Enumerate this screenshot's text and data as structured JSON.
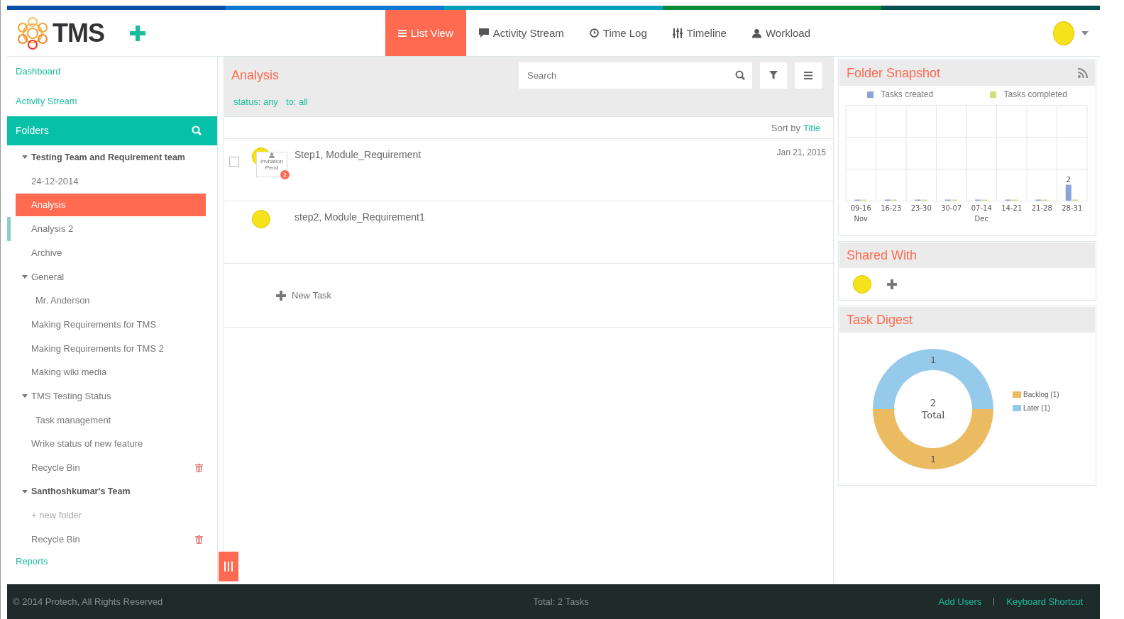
{
  "top_bar": {
    "logo": "TMS",
    "tabs": [
      {
        "label": "List View",
        "selected": true
      },
      {
        "label": "Activity Stream",
        "selected": false
      },
      {
        "label": "Time Log",
        "selected": false
      },
      {
        "label": "Timeline",
        "selected": false
      },
      {
        "label": "Workload",
        "selected": false
      }
    ]
  },
  "sidebar": {
    "links": [
      "Dashboard",
      "Activity Stream"
    ],
    "folders_title": "Folders",
    "tree": [
      {
        "label": "Testing Team and Requirement team",
        "kind": "team",
        "expanded": true,
        "selected": false,
        "highlighted": false,
        "children": [
          {
            "label": "24-12-2014",
            "kind": "folder",
            "selected": false,
            "highlighted": false
          },
          {
            "label": "Analysis",
            "kind": "folder",
            "selected": true,
            "highlighted": false
          },
          {
            "label": "Analysis 2",
            "kind": "folder",
            "selected": false,
            "highlighted": true
          },
          {
            "label": "Archive",
            "kind": "folder",
            "selected": false,
            "highlighted": false
          },
          {
            "label": "General",
            "kind": "folder",
            "expanded": true,
            "selected": false,
            "highlighted": false,
            "children": [
              {
                "label": "Mr. Anderson",
                "kind": "folder",
                "selected": false,
                "highlighted": false
              }
            ]
          },
          {
            "label": "Making Requirements for TMS",
            "kind": "folder",
            "selected": false,
            "highlighted": false
          },
          {
            "label": "Making Requirements for TMS 2",
            "kind": "folder",
            "selected": false,
            "highlighted": false
          },
          {
            "label": "Making wiki media",
            "kind": "folder",
            "selected": false,
            "highlighted": false
          },
          {
            "label": "TMS Testing Status",
            "kind": "folder",
            "expanded": true,
            "selected": false,
            "highlighted": false,
            "children": [
              {
                "label": "Task management",
                "kind": "folder",
                "selected": false,
                "highlighted": false
              }
            ]
          },
          {
            "label": "Wrike status of new feature",
            "kind": "folder",
            "selected": false,
            "highlighted": false
          },
          {
            "label": "Recycle Bin",
            "kind": "bin",
            "selected": false,
            "highlighted": false
          }
        ]
      },
      {
        "label": "Santhoshkumar's Team",
        "kind": "team",
        "expanded": true,
        "selected": false,
        "highlighted": false,
        "children": [
          {
            "label": "+ new folder",
            "kind": "new",
            "selected": false,
            "highlighted": false
          },
          {
            "label": "Recycle Bin",
            "kind": "bin",
            "selected": false,
            "highlighted": false
          }
        ]
      }
    ],
    "reports": "Reports"
  },
  "main": {
    "title": "Analysis",
    "search": {
      "placeholder": "Search"
    },
    "filters": [
      "status: any",
      "to: all"
    ],
    "sort": {
      "label": "Sort by",
      "value": "Title"
    },
    "tasks": [
      {
        "title": "Step1, Module_Requirement",
        "date": "Jan 21, 2015",
        "checkbox": {
          "checked": false
        },
        "invitation": "Invitation Pend",
        "badge": "2"
      },
      {
        "title": "step2, Module_Requirement1"
      }
    ],
    "new_task": "New Task"
  },
  "right_panel": {
    "snapshot": {
      "title": "Folder Snapshot",
      "chart_data": {
        "type": "bar",
        "categories": [
          "09-16",
          "16-23",
          "23-30",
          "30-07",
          "07-14",
          "14-21",
          "21-28",
          "28-31"
        ],
        "series": [
          {
            "name": "Tasks created",
            "color": "#8aa4d6",
            "values": [
              0,
              0,
              0,
              0,
              0,
              0,
              0,
              2
            ],
            "value_labels": [
              null,
              null,
              null,
              null,
              null,
              null,
              null,
              "2"
            ]
          },
          {
            "name": "Tasks completed",
            "color": "#cfe07a",
            "values": [
              0,
              0,
              0,
              0,
              0,
              0,
              0,
              0
            ],
            "value_labels": [
              null,
              null,
              null,
              null,
              null,
              null,
              null,
              null
            ]
          }
        ],
        "ylim": [
          0,
          12
        ]
      },
      "month_labels": [
        "Nov",
        "Dec"
      ]
    },
    "shared_with": {
      "title": "Shared With"
    },
    "digest": {
      "title": "Task Digest",
      "total": {
        "value": "2",
        "label": "Total"
      },
      "chart_data": {
        "type": "donut",
        "categories": [
          "Backlog (1)",
          "Later (1)"
        ],
        "series": [
          {
            "values": [
              1,
              1
            ],
            "value_labels": [
              "1",
              "1"
            ]
          }
        ],
        "colors": [
          "#ebbb62",
          "#95caea"
        ]
      }
    }
  },
  "footer": {
    "copyright": "© 2014 Protech, All Rights Reserved",
    "total": "Total: 2 Tasks",
    "links": [
      "Add Users",
      "Keyboard Shortcut"
    ]
  }
}
